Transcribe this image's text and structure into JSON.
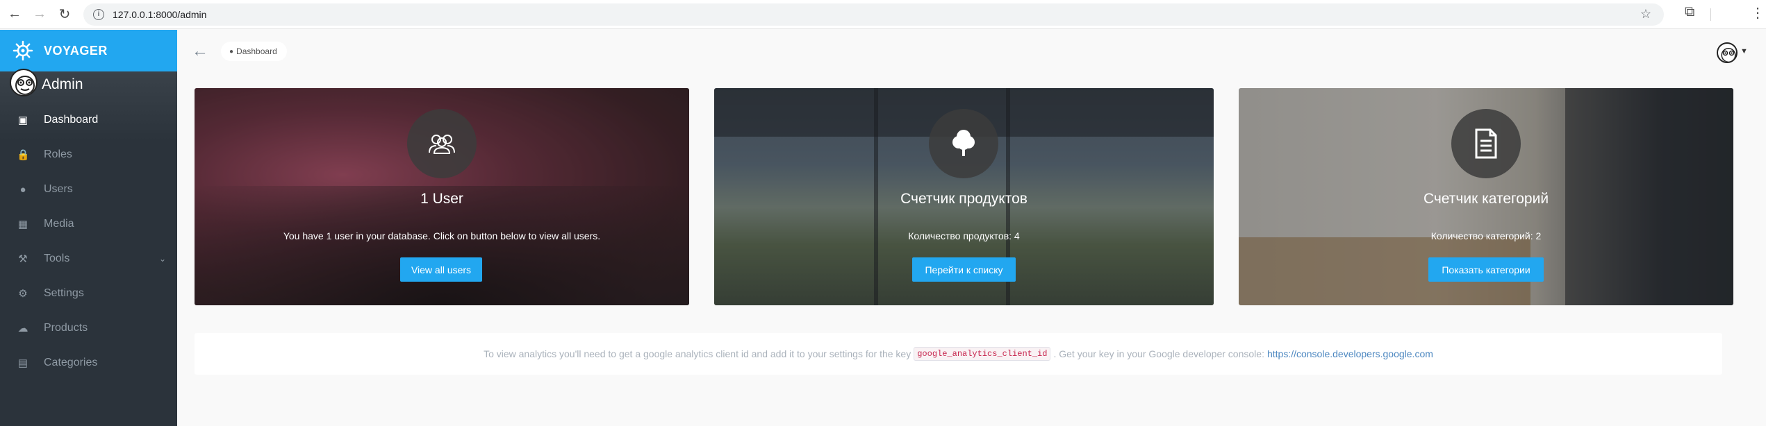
{
  "browser": {
    "url": "127.0.0.1:8000/admin"
  },
  "sidebar": {
    "brand": "VOYAGER",
    "admin_name": "Admin",
    "items": [
      {
        "label": "Dashboard",
        "icon": "dashboard-icon"
      },
      {
        "label": "Roles",
        "icon": "lock-icon"
      },
      {
        "label": "Users",
        "icon": "person-icon"
      },
      {
        "label": "Media",
        "icon": "image-icon"
      },
      {
        "label": "Tools",
        "icon": "tools-icon"
      },
      {
        "label": "Settings",
        "icon": "gear-icon"
      },
      {
        "label": "Products",
        "icon": "tree-icon"
      },
      {
        "label": "Categories",
        "icon": "document-icon"
      }
    ]
  },
  "header": {
    "breadcrumb": "Dashboard"
  },
  "cards": [
    {
      "title": "1 User",
      "text": "You have 1 user in your database. Click on button below to view all users.",
      "button": "View all users"
    },
    {
      "title": "Счетчик продуктов",
      "text": "Количество продуктов: 4",
      "button": "Перейти к списку"
    },
    {
      "title": "Счетчик категорий",
      "text": "Количество категорий: 2",
      "button": "Показать категории"
    }
  ],
  "analytics": {
    "text_before": "To view analytics you'll need to get a google analytics client id and add it to your settings for the key",
    "key": "google_analytics_client_id",
    "text_after": ". Get your key in your Google developer console:",
    "link": "https://console.developers.google.com"
  },
  "colors": {
    "accent": "#22a7f0",
    "sidebar_bg": "#2b333b",
    "link": "#4c87c0"
  }
}
